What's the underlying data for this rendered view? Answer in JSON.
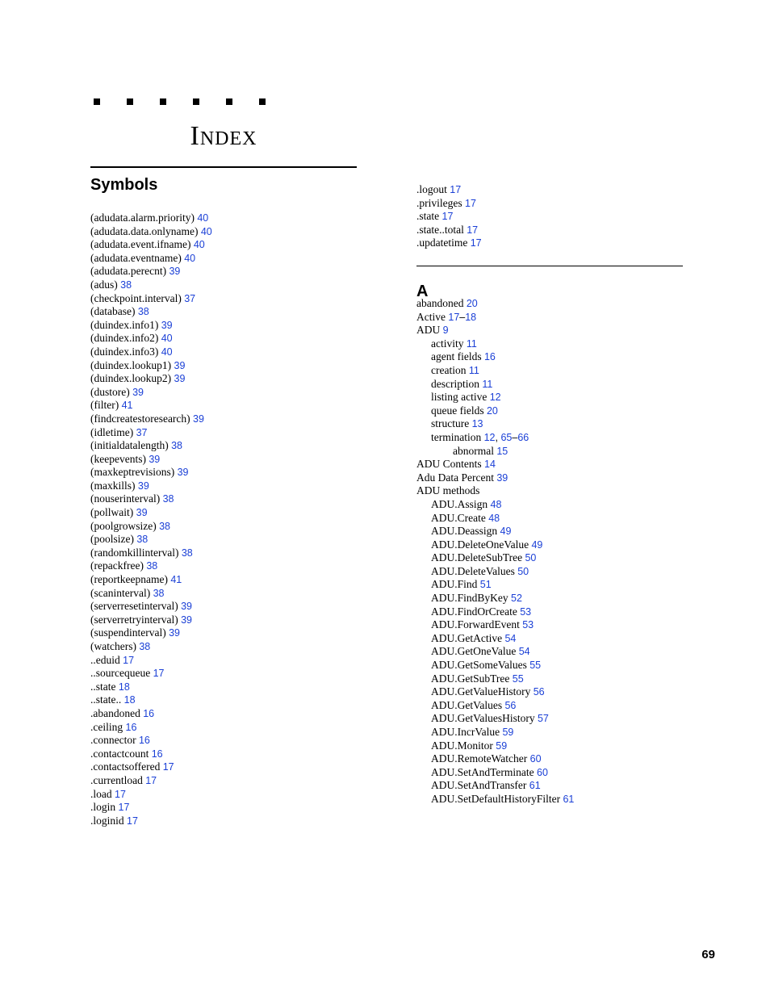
{
  "title": "Index",
  "page_number": "69",
  "sections": {
    "symbols": "Symbols",
    "a": "A"
  },
  "left_col": [
    {
      "t": "(adudata.alarm.priority)",
      "p": [
        "40"
      ]
    },
    {
      "t": "(adudata.data.onlyname)",
      "p": [
        "40"
      ]
    },
    {
      "t": "(adudata.event.ifname)",
      "p": [
        "40"
      ]
    },
    {
      "t": "(adudata.eventname)",
      "p": [
        "40"
      ]
    },
    {
      "t": "(adudata.perecnt)",
      "p": [
        "39"
      ]
    },
    {
      "t": "(adus)",
      "p": [
        "38"
      ]
    },
    {
      "t": "(checkpoint.interval)",
      "p": [
        "37"
      ]
    },
    {
      "t": "(database)",
      "p": [
        "38"
      ]
    },
    {
      "t": "(duindex.info1)",
      "p": [
        "39"
      ]
    },
    {
      "t": "(duindex.info2)",
      "p": [
        "40"
      ]
    },
    {
      "t": "(duindex.info3)",
      "p": [
        "40"
      ]
    },
    {
      "t": "(duindex.lookup1)",
      "p": [
        "39"
      ]
    },
    {
      "t": "(duindex.lookup2)",
      "p": [
        "39"
      ]
    },
    {
      "t": "(dustore)",
      "p": [
        "39"
      ]
    },
    {
      "t": "(filter)",
      "p": [
        "41"
      ]
    },
    {
      "t": "(findcreatestoresearch)",
      "p": [
        "39"
      ]
    },
    {
      "t": "(idletime)",
      "p": [
        "37"
      ]
    },
    {
      "t": "(initialdatalength)",
      "p": [
        "38"
      ]
    },
    {
      "t": "(keepevents)",
      "p": [
        "39"
      ]
    },
    {
      "t": "(maxkeptrevisions)",
      "p": [
        "39"
      ]
    },
    {
      "t": "(maxkills)",
      "p": [
        "39"
      ]
    },
    {
      "t": "(nouserinterval)",
      "p": [
        "38"
      ]
    },
    {
      "t": "(pollwait)",
      "p": [
        "39"
      ]
    },
    {
      "t": "(poolgrowsize)",
      "p": [
        "38"
      ]
    },
    {
      "t": "(poolsize)",
      "p": [
        "38"
      ]
    },
    {
      "t": "(randomkillinterval)",
      "p": [
        "38"
      ]
    },
    {
      "t": "(repackfree)",
      "p": [
        "38"
      ]
    },
    {
      "t": "(reportkeepname)",
      "p": [
        "41"
      ]
    },
    {
      "t": "(scaninterval)",
      "p": [
        "38"
      ]
    },
    {
      "t": "(serverresetinterval)",
      "p": [
        "39"
      ]
    },
    {
      "t": "(serverretryinterval)",
      "p": [
        "39"
      ]
    },
    {
      "t": "(suspendinterval)",
      "p": [
        "39"
      ]
    },
    {
      "t": "(watchers)",
      "p": [
        "38"
      ]
    },
    {
      "t": "..eduid",
      "p": [
        "17"
      ]
    },
    {
      "t": "..sourcequeue",
      "p": [
        "17"
      ]
    },
    {
      "t": "..state",
      "p": [
        "18"
      ]
    },
    {
      "t": "..state..",
      "p": [
        "18"
      ]
    },
    {
      "t": ".abandoned",
      "p": [
        "16"
      ]
    },
    {
      "t": ".ceiling",
      "p": [
        "16"
      ]
    },
    {
      "t": ".connector",
      "p": [
        "16"
      ]
    },
    {
      "t": ".contactcount",
      "p": [
        "16"
      ]
    },
    {
      "t": ".contactsoffered",
      "p": [
        "17"
      ]
    },
    {
      "t": ".currentload",
      "p": [
        "17"
      ]
    },
    {
      "t": ".load",
      "p": [
        "17"
      ]
    },
    {
      "t": ".login",
      "p": [
        "17"
      ]
    },
    {
      "t": ".loginid",
      "p": [
        "17"
      ]
    }
  ],
  "right_top": [
    {
      "t": ".logout",
      "p": [
        "17"
      ]
    },
    {
      "t": ".privileges",
      "p": [
        "17"
      ]
    },
    {
      "t": ".state",
      "p": [
        "17"
      ]
    },
    {
      "t": ".state..total",
      "p": [
        "17"
      ]
    },
    {
      "t": ".updatetime",
      "p": [
        "17"
      ]
    }
  ],
  "right_bot": [
    {
      "t": "abandoned",
      "p": [
        "20"
      ],
      "i": 0
    },
    {
      "t": "Active",
      "p": [
        "17",
        "–",
        "18"
      ],
      "i": 0,
      "range": true
    },
    {
      "t": "ADU",
      "p": [
        "9"
      ],
      "i": 0
    },
    {
      "t": "activity",
      "p": [
        "11"
      ],
      "i": 1
    },
    {
      "t": "agent fields",
      "p": [
        "16"
      ],
      "i": 1
    },
    {
      "t": "creation",
      "p": [
        "11"
      ],
      "i": 1
    },
    {
      "t": "description",
      "p": [
        "11"
      ],
      "i": 1
    },
    {
      "t": "listing active",
      "p": [
        "12"
      ],
      "i": 1
    },
    {
      "t": "queue fields",
      "p": [
        "20"
      ],
      "i": 1
    },
    {
      "t": "structure",
      "p": [
        "13"
      ],
      "i": 1
    },
    {
      "t": "termination",
      "p": [
        "12",
        ",",
        "65",
        "–",
        "66"
      ],
      "i": 1
    },
    {
      "t": "abnormal",
      "p": [
        "15"
      ],
      "i": 2
    },
    {
      "t": "ADU Contents",
      "p": [
        "14"
      ],
      "i": 0
    },
    {
      "t": "Adu Data Percent",
      "p": [
        "39"
      ],
      "i": 0
    },
    {
      "t": "ADU methods",
      "p": [],
      "i": 0
    },
    {
      "t": "ADU.Assign",
      "p": [
        "48"
      ],
      "i": 1
    },
    {
      "t": "ADU.Create",
      "p": [
        "48"
      ],
      "i": 1
    },
    {
      "t": "ADU.Deassign",
      "p": [
        "49"
      ],
      "i": 1
    },
    {
      "t": "ADU.DeleteOneValue",
      "p": [
        "49"
      ],
      "i": 1
    },
    {
      "t": "ADU.DeleteSubTree",
      "p": [
        "50"
      ],
      "i": 1
    },
    {
      "t": "ADU.DeleteValues",
      "p": [
        "50"
      ],
      "i": 1
    },
    {
      "t": "ADU.Find",
      "p": [
        "51"
      ],
      "i": 1
    },
    {
      "t": "ADU.FindByKey",
      "p": [
        "52"
      ],
      "i": 1
    },
    {
      "t": "ADU.FindOrCreate",
      "p": [
        "53"
      ],
      "i": 1
    },
    {
      "t": "ADU.ForwardEvent",
      "p": [
        "53"
      ],
      "i": 1
    },
    {
      "t": "ADU.GetActive",
      "p": [
        "54"
      ],
      "i": 1
    },
    {
      "t": "ADU.GetOneValue",
      "p": [
        "54"
      ],
      "i": 1
    },
    {
      "t": "ADU.GetSomeValues",
      "p": [
        "55"
      ],
      "i": 1
    },
    {
      "t": "ADU.GetSubTree",
      "p": [
        "55"
      ],
      "i": 1
    },
    {
      "t": "ADU.GetValueHistory",
      "p": [
        "56"
      ],
      "i": 1
    },
    {
      "t": "ADU.GetValues",
      "p": [
        "56"
      ],
      "i": 1
    },
    {
      "t": "ADU.GetValuesHistory",
      "p": [
        "57"
      ],
      "i": 1
    },
    {
      "t": "ADU.IncrValue",
      "p": [
        "59"
      ],
      "i": 1
    },
    {
      "t": "ADU.Monitor",
      "p": [
        "59"
      ],
      "i": 1
    },
    {
      "t": "ADU.RemoteWatcher",
      "p": [
        "60"
      ],
      "i": 1
    },
    {
      "t": "ADU.SetAndTerminate",
      "p": [
        "60"
      ],
      "i": 1
    },
    {
      "t": "ADU.SetAndTransfer",
      "p": [
        "61"
      ],
      "i": 1
    },
    {
      "t": "ADU.SetDefaultHistoryFilter",
      "p": [
        "61"
      ],
      "i": 1
    }
  ]
}
